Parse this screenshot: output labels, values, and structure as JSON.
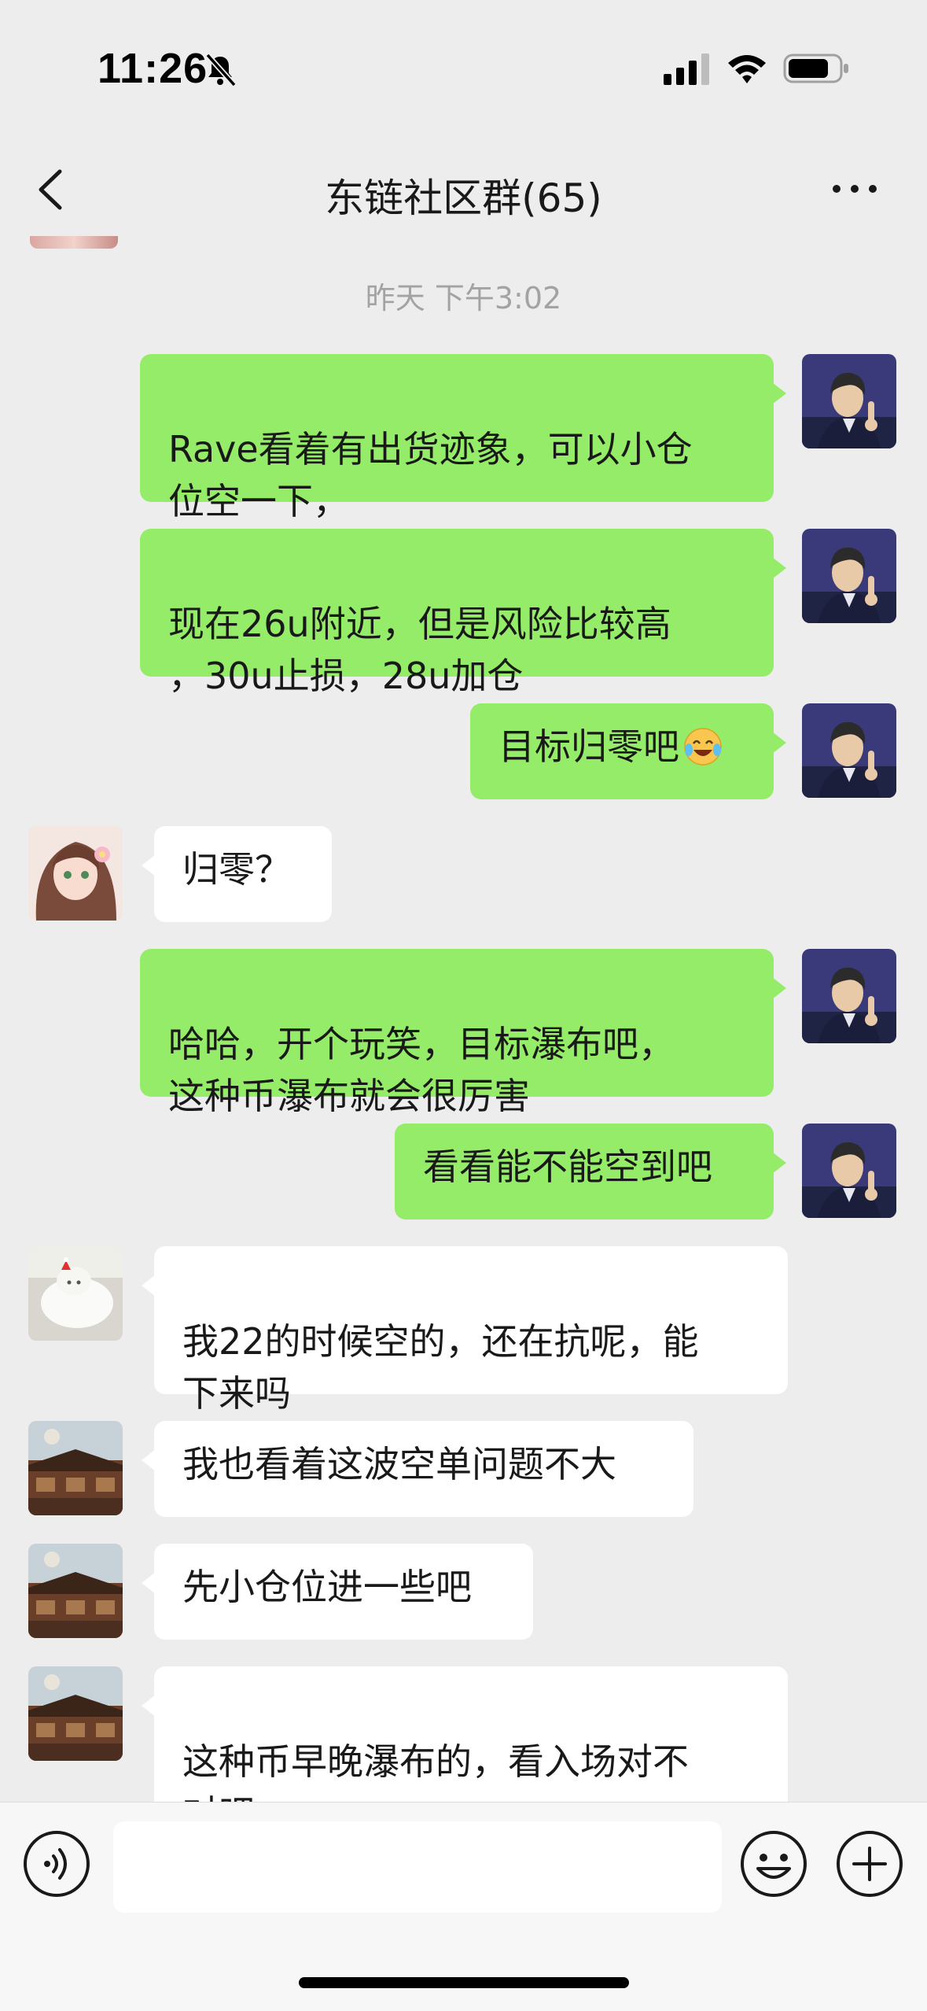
{
  "status_bar": {
    "time": "11:26"
  },
  "nav": {
    "title": "东链社区群(65)"
  },
  "chat": {
    "timestamp": "昨天 下午3:02",
    "messages": [
      {
        "side": "out",
        "avatar": "man-avatar",
        "text": "Rave看着有出货迹象，可以小仓\n位空一下，"
      },
      {
        "side": "out",
        "avatar": "man-avatar",
        "text": "现在26u附近，但是风险比较高\n，30u止损，28u加仓"
      },
      {
        "side": "out",
        "avatar": "man-avatar",
        "text": "目标归零吧",
        "emoji": "laughing-crying-emoji"
      },
      {
        "side": "in",
        "avatar": "girl-avatar",
        "text": "归零？"
      },
      {
        "side": "out",
        "avatar": "man-avatar",
        "text": "哈哈，开个玩笑，目标瀑布吧，\n这种币瀑布就会很厉害"
      },
      {
        "side": "out",
        "avatar": "man-avatar",
        "text": "看看能不能空到吧"
      },
      {
        "side": "in",
        "avatar": "cat-avatar",
        "text": "我22的时候空的，还在抗呢，能\n下来吗"
      },
      {
        "side": "in",
        "avatar": "building-avatar",
        "text": "我也看着这波空单问题不大"
      },
      {
        "side": "in",
        "avatar": "building-avatar",
        "text": "先小仓位进一些吧"
      },
      {
        "side": "in",
        "avatar": "building-avatar",
        "text": "这种币早晚瀑布的，看入场对不\n对吧"
      }
    ]
  },
  "input": {
    "value": "",
    "placeholder": ""
  },
  "colors": {
    "background": "#EDEDED",
    "outgoing_bubble": "#95EC69",
    "incoming_bubble": "#FFFFFF",
    "timestamp": "#A3A3A3"
  }
}
